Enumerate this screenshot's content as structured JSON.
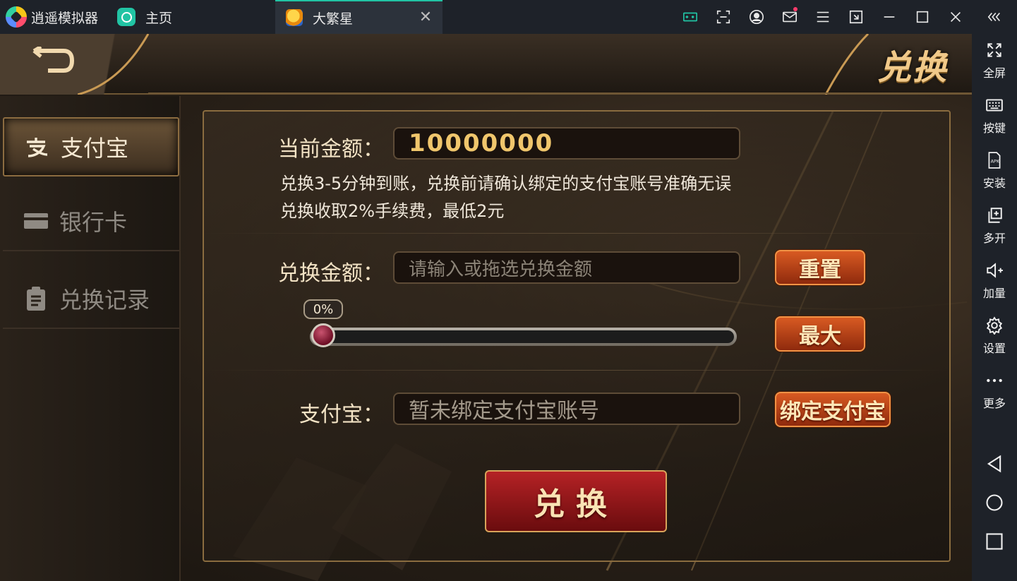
{
  "emulator": {
    "app_name": "逍遥模拟器",
    "home_tab": "主页",
    "active_tab": "大繁星",
    "sidebar": [
      {
        "label": "全屏",
        "icon": "fullscreen-icon"
      },
      {
        "label": "按键",
        "icon": "keyboard-icon"
      },
      {
        "label": "安装",
        "icon": "apk-icon"
      },
      {
        "label": "多开",
        "icon": "multi-instance-icon"
      },
      {
        "label": "加量",
        "icon": "volume-up-icon"
      },
      {
        "label": "设置",
        "icon": "gear-icon"
      },
      {
        "label": "更多",
        "icon": "more-icon"
      }
    ]
  },
  "game": {
    "title": "兑换",
    "nav": [
      {
        "label": "支付宝",
        "icon": "alipay-icon",
        "active": true
      },
      {
        "label": "银行卡",
        "icon": "bank-card-icon",
        "active": false
      },
      {
        "label": "兑换记录",
        "icon": "clipboard-icon",
        "active": false
      }
    ],
    "balance": {
      "label": "当前金额：",
      "value": "10000000"
    },
    "info_lines": [
      "兑换3-5分钟到账，兑换前请确认绑定的支付宝账号准确无误",
      "兑换收取2%手续费，最低2元"
    ],
    "exchange": {
      "label": "兑换金额：",
      "placeholder": "请输入或拖选兑换金额",
      "reset_label": "重置",
      "max_label": "最大",
      "slider_percent": "0%",
      "slider_value": 0
    },
    "alipay": {
      "label": "支付宝：",
      "value": "暂未绑定支付宝账号",
      "bind_label": "绑定支付宝"
    },
    "submit_label": "兑换"
  },
  "colors": {
    "accent": "#21c4a4",
    "gold": "#f0c66c",
    "button_orange": "#d85a22",
    "submit_red": "#b52225"
  }
}
